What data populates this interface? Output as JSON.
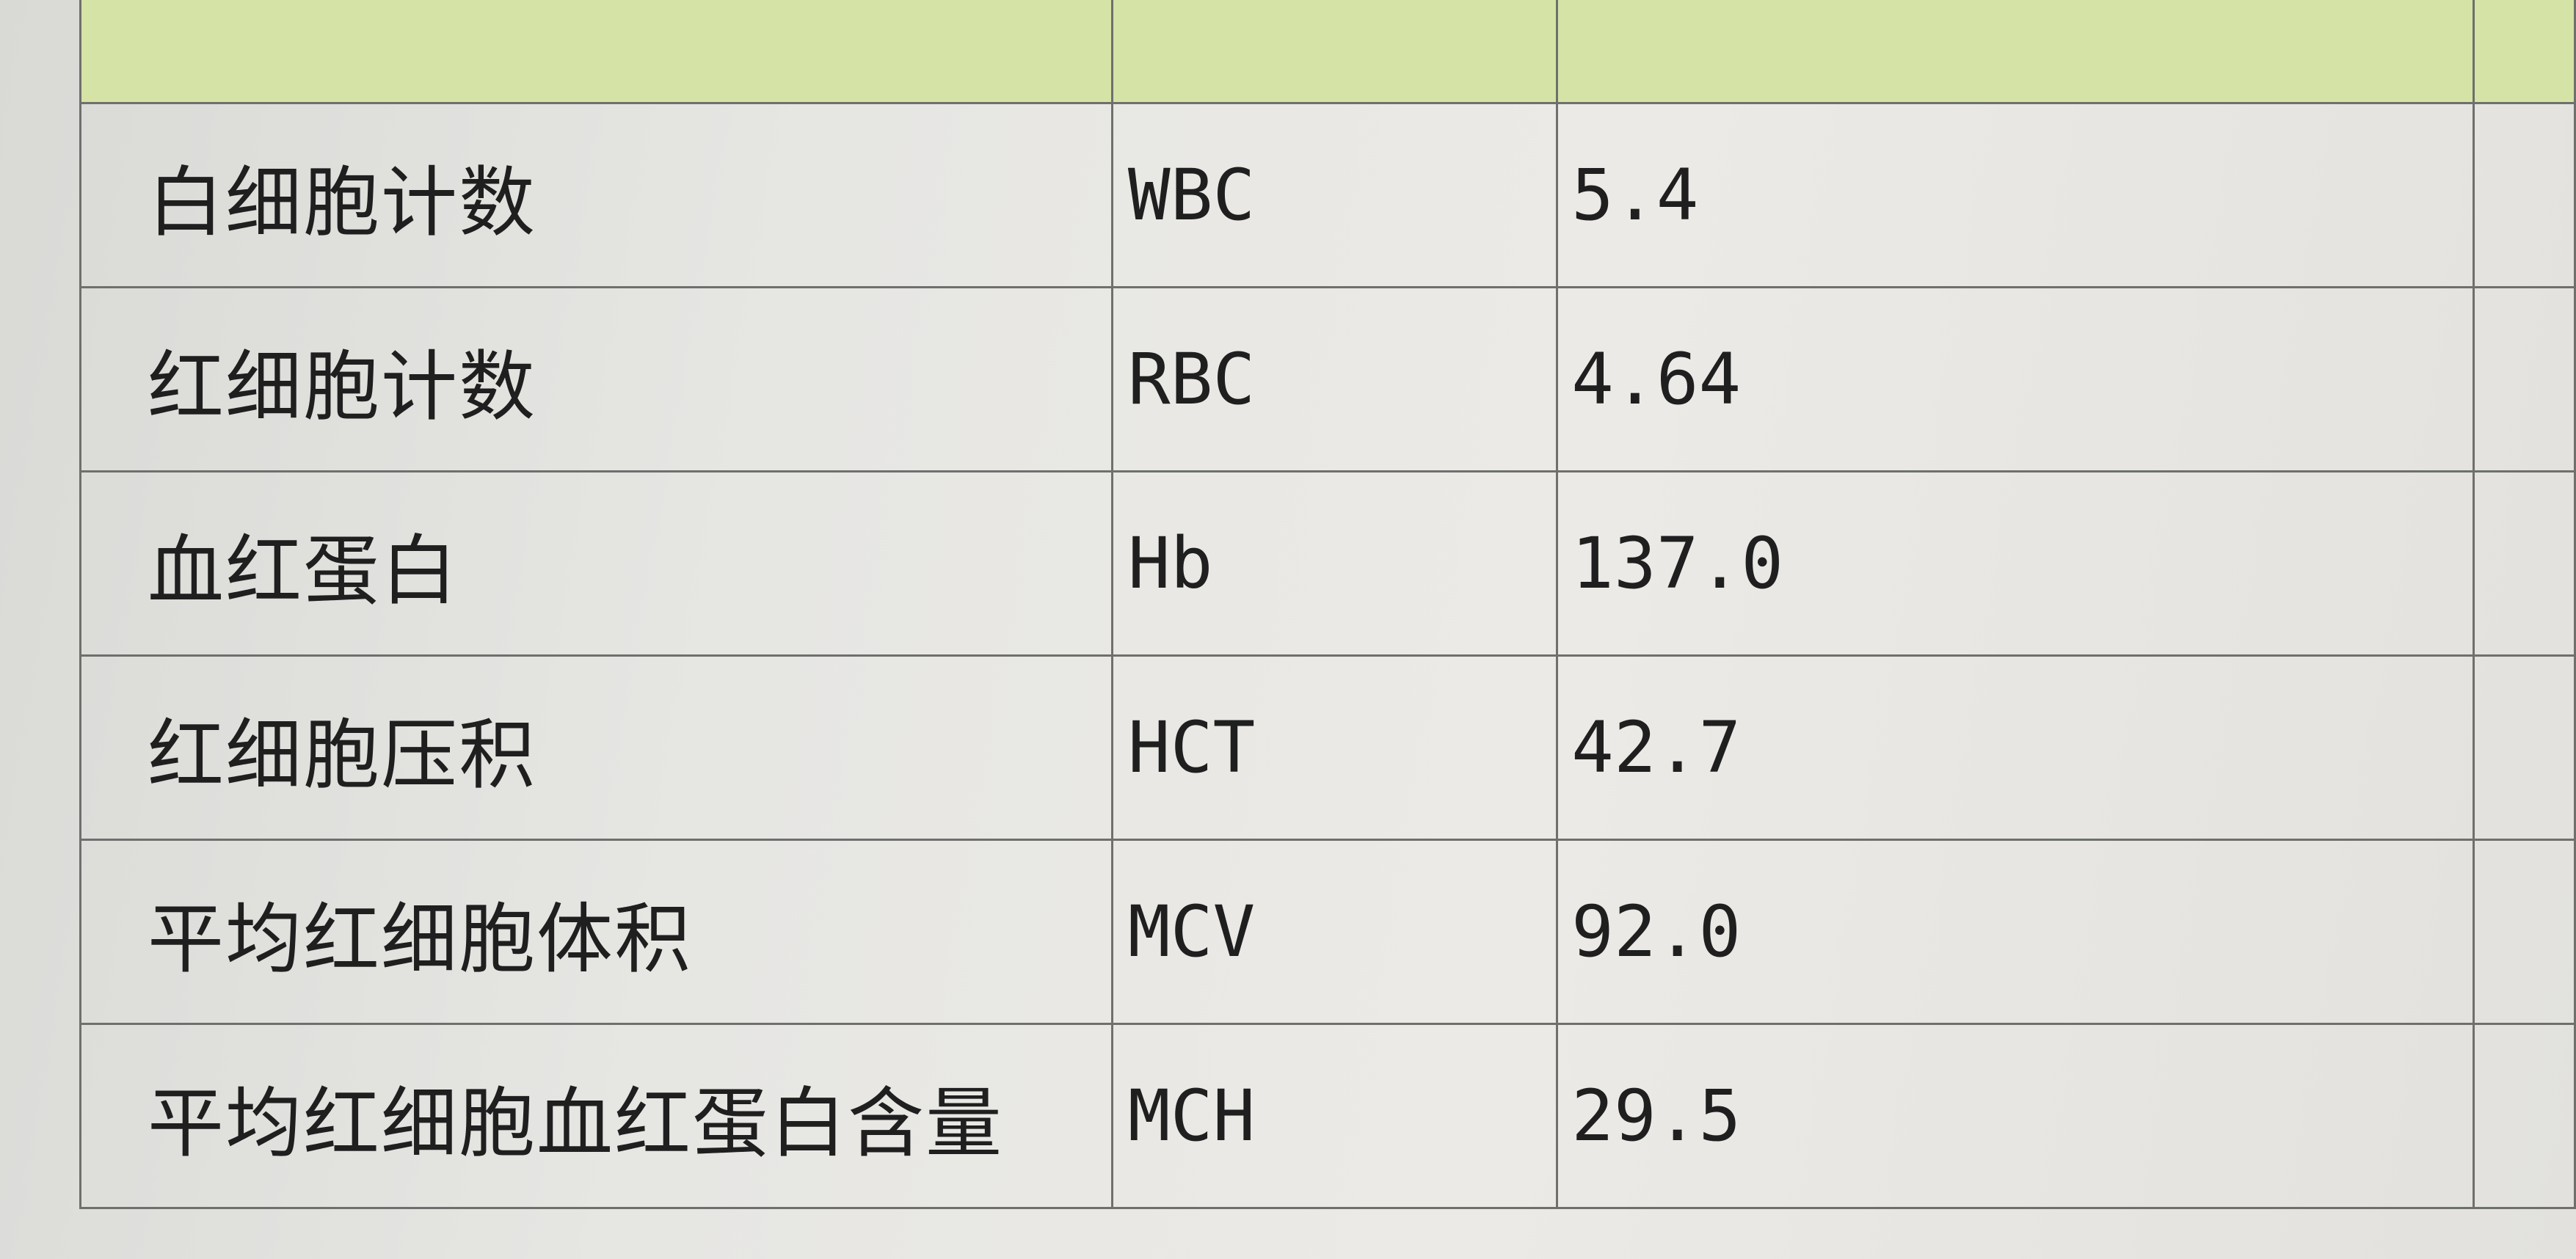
{
  "rows": [
    {
      "name": "白细胞计数",
      "code": "WBC",
      "result": "5.4"
    },
    {
      "name": "红细胞计数",
      "code": "RBC",
      "result": "4.64"
    },
    {
      "name": "血红蛋白",
      "code": "Hb",
      "result": "137.0"
    },
    {
      "name": "红细胞压积",
      "code": "HCT",
      "result": "42.7"
    },
    {
      "name": "平均红细胞体积",
      "code": "MCV",
      "result": "92.0"
    },
    {
      "name": "平均红细胞血红蛋白含量",
      "code": "MCH",
      "result": "29.5"
    }
  ],
  "colors": {
    "header_background": "#d5e3a6",
    "grid_line": "#6f6f6d",
    "paper": "#e6e6e3"
  }
}
